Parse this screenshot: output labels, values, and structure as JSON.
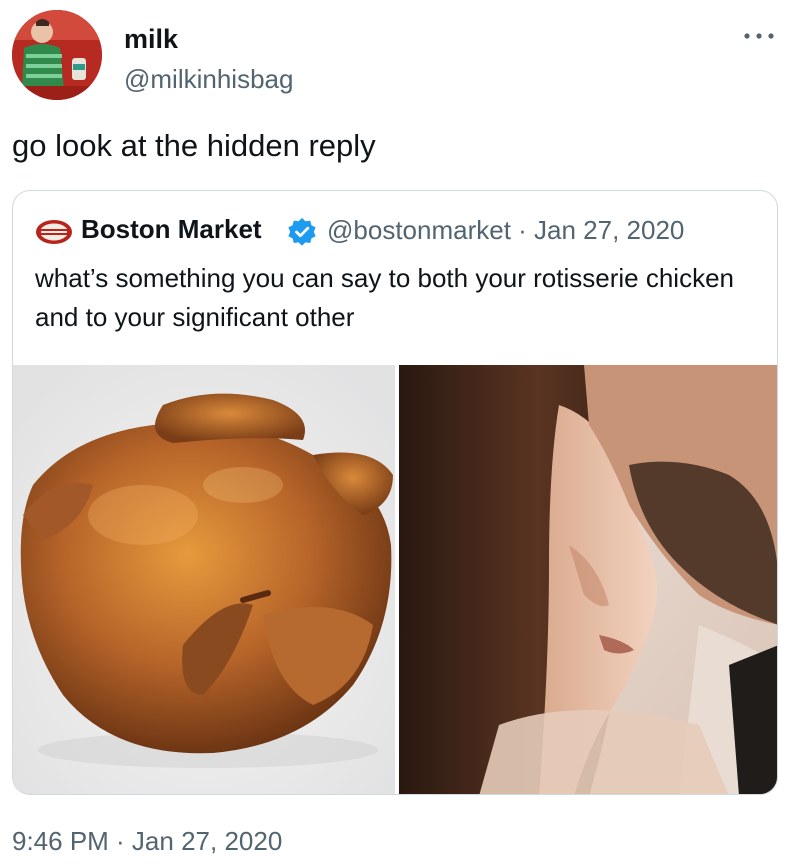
{
  "author": {
    "display_name": "milk",
    "handle": "@milkinhisbag"
  },
  "tweet": {
    "text": "go look at the hidden reply",
    "timestamp": "9:46 PM · Jan 27, 2020"
  },
  "quote": {
    "display_name": "Boston Market",
    "handle_date": "@bostonmarket · Jan 27, 2020",
    "text": "what’s something you can say to both your rotisserie chicken and to your significant other",
    "logo_text": "Boston Market"
  },
  "colors": {
    "text_primary": "#0f1419",
    "text_secondary": "#536471",
    "border": "#cfd9de",
    "verified": "#1d9bf0",
    "logo_red": "#b8241c"
  }
}
